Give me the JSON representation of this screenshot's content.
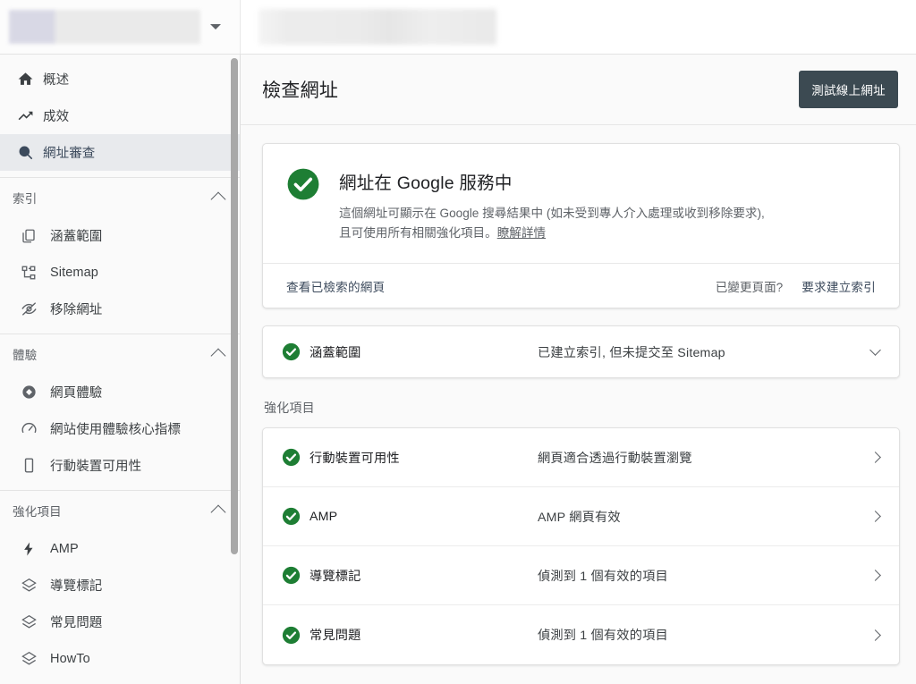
{
  "topbar": {
    "property_selector_label": "",
    "property_caret_icon": "chevron-down-icon",
    "search_placeholder": ""
  },
  "sidebar": {
    "primary": [
      {
        "label": "概述",
        "icon": "home-icon",
        "selected": false
      },
      {
        "label": "成效",
        "icon": "trending-up-icon",
        "selected": false
      },
      {
        "label": "網址審查",
        "icon": "search-icon",
        "selected": true
      }
    ],
    "groups": [
      {
        "title": "索引",
        "collapse_icon": "chevron-up-icon",
        "items": [
          {
            "label": "涵蓋範圍",
            "icon": "pages-icon"
          },
          {
            "label": "Sitemap",
            "icon": "sitemap-icon"
          },
          {
            "label": "移除網址",
            "icon": "eye-off-icon"
          }
        ]
      },
      {
        "title": "體驗",
        "collapse_icon": "chevron-up-icon",
        "items": [
          {
            "label": "網頁體驗",
            "icon": "page-experience-icon"
          },
          {
            "label": "網站使用體驗核心指標",
            "icon": "speedometer-icon"
          },
          {
            "label": "行動裝置可用性",
            "icon": "mobile-icon"
          }
        ]
      },
      {
        "title": "強化項目",
        "collapse_icon": "chevron-up-icon",
        "items": [
          {
            "label": "AMP",
            "icon": "bolt-icon"
          },
          {
            "label": "導覽標記",
            "icon": "layers-icon"
          },
          {
            "label": "常見問題",
            "icon": "layers-icon"
          },
          {
            "label": "HowTo",
            "icon": "layers-icon"
          }
        ]
      }
    ],
    "scrollbar": "vertical-scrollbar"
  },
  "main": {
    "header": {
      "title": "檢查網址",
      "test_button": "測試線上網址"
    },
    "status_card": {
      "status_icon": "check-circle-icon",
      "title": "網址在 Google 服務中",
      "description_line1": "這個網址可顯示在 Google 搜尋結果中 (如未受到專人介入處理或收到移除要求),",
      "description_line2": "且可使用所有相關強化項目。",
      "learn_more": "瞭解詳情",
      "view_crawled_page": "查看已檢索的網頁",
      "page_changed_question": "已變更頁面?",
      "request_indexing": "要求建立索引"
    },
    "coverage_row": {
      "status_icon": "check-circle-icon",
      "label": "涵蓋範圍",
      "value": "已建立索引, 但未提交至 Sitemap",
      "expand_icon": "chevron-down-icon"
    },
    "enhancements_section_label": "強化項目",
    "enhancements": [
      {
        "status_icon": "check-circle-icon",
        "label": "行動裝置可用性",
        "value": "網頁適合透過行動裝置瀏覽",
        "chevron_icon": "chevron-right-icon"
      },
      {
        "status_icon": "check-circle-icon",
        "label": "AMP",
        "value": "AMP 網頁有效",
        "chevron_icon": "chevron-right-icon"
      },
      {
        "status_icon": "check-circle-icon",
        "label": "導覽標記",
        "value": "偵測到 1 個有效的項目",
        "chevron_icon": "chevron-right-icon"
      },
      {
        "status_icon": "check-circle-icon",
        "label": "常見問題",
        "value": "偵測到 1 個有效的項目",
        "chevron_icon": "chevron-right-icon"
      }
    ]
  },
  "colors": {
    "success_green": "#188038",
    "button_slate": "#3c4a52",
    "selected_nav": "#e8eaed",
    "body_bg": "#fafafa",
    "card_bg": "#ffffff",
    "text_primary": "#202124",
    "text_secondary": "#5f6368"
  }
}
